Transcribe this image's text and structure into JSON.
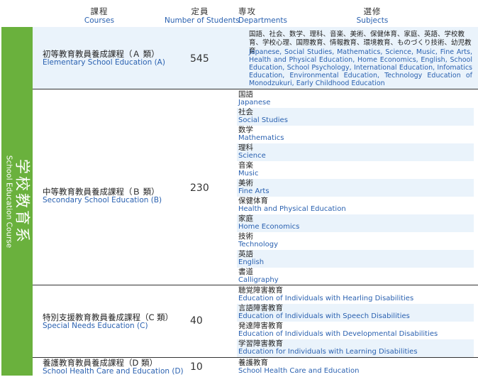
{
  "header": {
    "courses_ja": "課程",
    "courses_en": "Courses",
    "students_ja": "定員",
    "students_en": "Number of Students",
    "departments_ja": "専攻",
    "departments_en": "Departments",
    "subjects_ja": "選修",
    "subjects_en": "Subjects"
  },
  "side": {
    "label_ja": "学校教育系",
    "label_en": "School Education Course",
    "color": "#6ab13d"
  },
  "courses": [
    {
      "name_ja": "初等教育教員養成課程（Ａ 類）",
      "name_en": "Elementary School Education (A)",
      "count": "545",
      "subjects_ja": "国語、社会、数学、理科、音楽、美術、保健体育、家庭、英語、学校教育、学校心理、国際教育、情報教育、環境教育、ものづくり技術、幼児教育",
      "subjects_en": "Japanese, Social Studies, Mathematics, Science, Music, Fine Arts, Health and Physical Education, Home Economics, English, School Education, School Psychology, International Education, Infomatics Education, Environmental Education, Technology Education of Monodzukuri, Early Childhood Education"
    },
    {
      "name_ja": "中等教育教員養成課程（Ｂ 類）",
      "name_en": "Secondary School Education (B)",
      "count": "230",
      "departments": [
        {
          "ja": "国語",
          "en": "Japanese"
        },
        {
          "ja": "社会",
          "en": "Social Studies"
        },
        {
          "ja": "数学",
          "en": "Mathematics"
        },
        {
          "ja": "理科",
          "en": "Science"
        },
        {
          "ja": "音楽",
          "en": "Music"
        },
        {
          "ja": "美術",
          "en": "Fine Arts"
        },
        {
          "ja": "保健体育",
          "en": "Health and Physical Education"
        },
        {
          "ja": "家庭",
          "en": "Home Economics"
        },
        {
          "ja": "技術",
          "en": "Technology"
        },
        {
          "ja": "英語",
          "en": "English"
        },
        {
          "ja": "書道",
          "en": "Calligraphy"
        }
      ]
    },
    {
      "name_ja": "特別支援教育教員養成課程（C 類）",
      "name_en": "Special Needs Education (C)",
      "count": "40",
      "departments": [
        {
          "ja": "聴覚障害教育",
          "en": "Education of Individuals with Hearling Disabilities"
        },
        {
          "ja": "言語障害教育",
          "en": "Education of Individuals with Speech Disabilities"
        },
        {
          "ja": "発達障害教育",
          "en": "Education of Individuals with Developmental Disabilities"
        },
        {
          "ja": "学習障害教育",
          "en": "Education for Individuals with Learning Disabilities"
        }
      ]
    },
    {
      "name_ja": "養護教育教員養成課程（D 類）",
      "name_en": "School Health Care and Education (D)",
      "count": "10",
      "departments": [
        {
          "ja": "養護教育",
          "en": "School Health Care and Education"
        }
      ]
    }
  ]
}
